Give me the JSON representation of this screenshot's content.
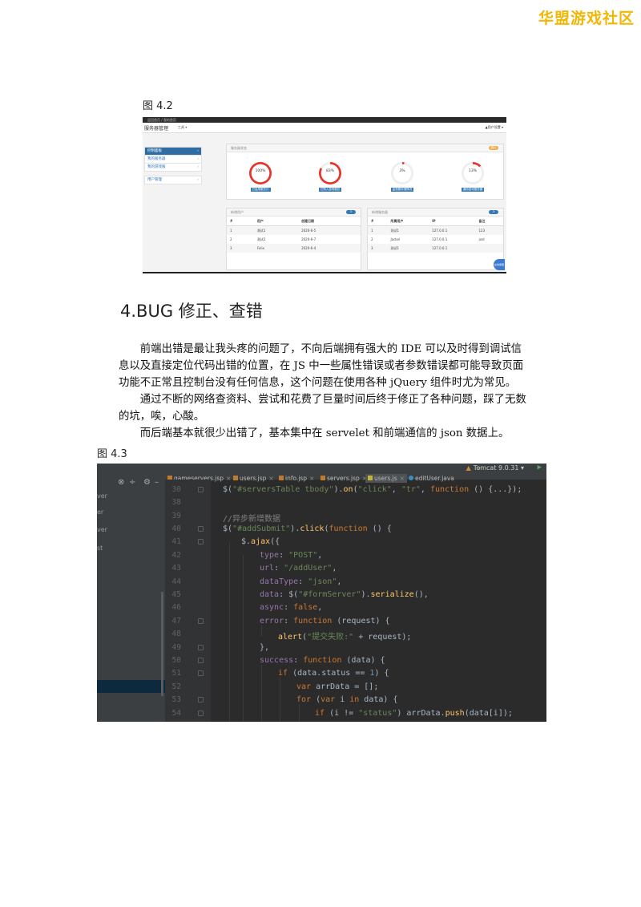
{
  "watermark": "华盟游戏社区",
  "figure_42": {
    "caption": "图 4.2",
    "topbar": "返回首页  / 我的首页",
    "brand": "服务器管理",
    "tool_menu": "工具 ▾",
    "user_menu": "▲用户设置 ▾",
    "sidebar": [
      {
        "label": "控制面板",
        "active": true
      },
      {
        "label": "我的服务器",
        "active": false
      },
      {
        "label": "我的游戏服",
        "active": false
      },
      {
        "label": "用户管理",
        "active": false
      }
    ],
    "status_panel": {
      "title": "服务器状态",
      "badge": "统计",
      "gauges": [
        {
          "value": "100%",
          "label": "已运用服总计",
          "percent": 100
        },
        {
          "value": "83%",
          "label": "已购入游戏服总",
          "percent": 83
        },
        {
          "value": "3%",
          "label": "监测服存储情况",
          "percent": 3
        },
        {
          "value": "13%",
          "label": "通用游戏服务器",
          "percent": 13
        }
      ]
    },
    "users_panel": {
      "title": "新增用户",
      "badge": "3",
      "headers": [
        "#",
        "用户",
        "创建日期"
      ],
      "rows": [
        [
          "1",
          "测试1",
          "2020-6-5"
        ],
        [
          "2",
          "测试2",
          "2020-6-7"
        ],
        [
          "3",
          "Felix",
          "2020-6-4"
        ]
      ]
    },
    "servers_panel": {
      "title": "新增服务器",
      "badge": "3",
      "headers": [
        "#",
        "所属用户",
        "IP",
        "备注"
      ],
      "rows": [
        [
          "1",
          "测试1",
          "127.0.0.1",
          "123"
        ],
        [
          "2",
          "Jackel",
          "127.0.0.1",
          "asd"
        ],
        [
          "3",
          "测试1",
          "127.0.0.1",
          ""
        ]
      ]
    },
    "chat_button": "在线客服"
  },
  "section": {
    "heading": "4.BUG 修正、查错",
    "paragraphs": [
      "前端出错是最让我头疼的问题了，不向后端拥有强大的 IDE 可以及时得到调试信息以及直接定位代码出错的位置，在 JS 中一些属性错误或者参数错误都可能导致页面功能不正常且控制台没有任何信息，这个问题在使用各种 jQuery 组件时尤为常见。",
      "通过不断的网络查资料、尝试和花费了巨量时间后终于修正了各种问题，踩了无数的坑，唉，心酸。",
      "而后端基本就很少出错了，基本集中在 servelet 和前端通信的 json 数据上。"
    ]
  },
  "figure_43": {
    "caption": "图 4.3",
    "tabs": [
      "gameservers.jsp",
      "users.jsp",
      "info.jsp",
      "servers.jsp",
      "users.js",
      "editUser.java"
    ],
    "active_tab": "users.js",
    "run_config": "Tomcat 9.0.31",
    "side_labels": [
      "ver",
      "er",
      "ver",
      "st"
    ],
    "code_lines": [
      {
        "num": "30",
        "text": "$(\"#serversTable tbody\").on(\"click\", \"tr\", function () {...});"
      },
      {
        "num": "38",
        "text": ""
      },
      {
        "num": "39",
        "text": "//异步新增数据"
      },
      {
        "num": "40",
        "text": "$(\"#addSubmit\").click(function () {"
      },
      {
        "num": "41",
        "text": "$.ajax({"
      },
      {
        "num": "42",
        "text": "type: \"POST\","
      },
      {
        "num": "43",
        "text": "url: \"/addUser\","
      },
      {
        "num": "44",
        "text": "dataType: \"json\","
      },
      {
        "num": "45",
        "text": "data: $(\"#formServer\").serialize(),"
      },
      {
        "num": "46",
        "text": "async: false,"
      },
      {
        "num": "47",
        "text": "error: function (request) {"
      },
      {
        "num": "48",
        "text": "alert(\"提交失败:\" + request);"
      },
      {
        "num": "49",
        "text": "},"
      },
      {
        "num": "50",
        "text": "success: function (data) {"
      },
      {
        "num": "51",
        "text": "if (data.status == 1) {"
      },
      {
        "num": "52",
        "text": "var arrData = [];"
      },
      {
        "num": "53",
        "text": "for (var i in data) {"
      },
      {
        "num": "54",
        "text": "if (i != \"status\") arrData.push(data[i]);"
      }
    ]
  }
}
